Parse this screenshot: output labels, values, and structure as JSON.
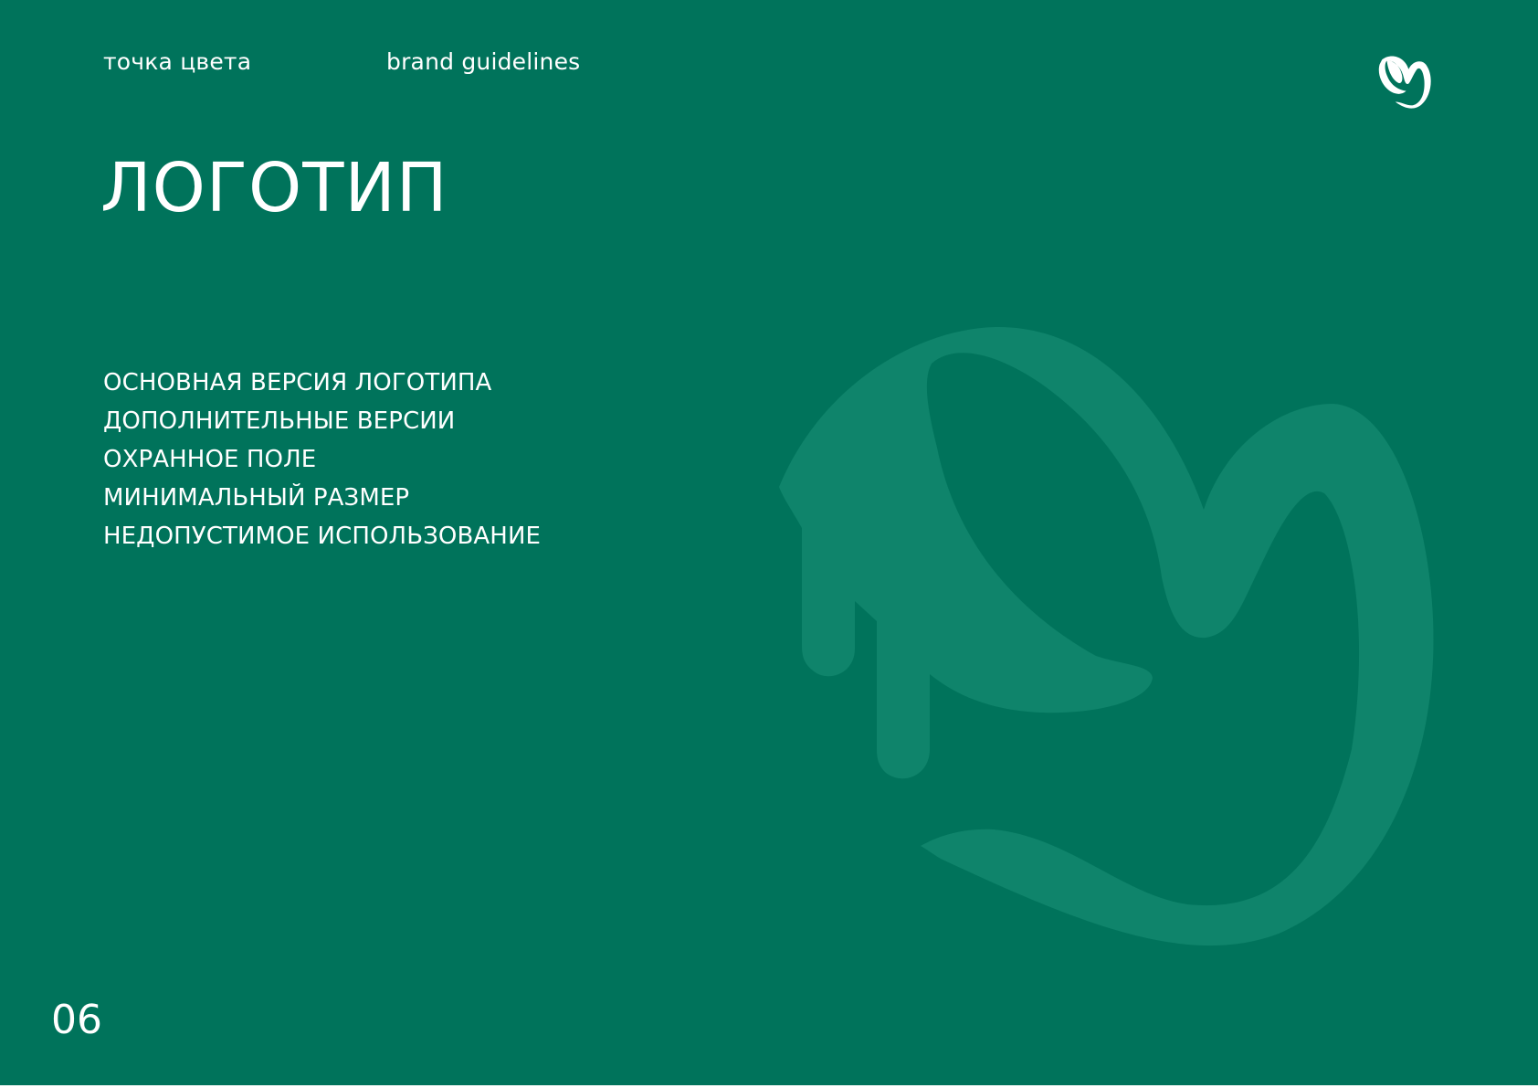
{
  "header": {
    "brand": "точка цвета",
    "subtitle": "brand guidelines",
    "logo_icon": "brand-mark-icon"
  },
  "title": "ЛОГОТИП",
  "contents": [
    "ОСНОВНАЯ ВЕРСИЯ ЛОГОТИПА",
    "ДОПОЛНИТЕЛЬНЫЕ ВЕРСИИ",
    "ОХРАННОЕ ПОЛЕ",
    "МИНИМАЛЬНЫЙ РАЗМЕР",
    "НЕДОПУСТИМОЕ ИСПОЛЬЗОВАНИЕ"
  ],
  "page_number": "06",
  "colors": {
    "background": "#00735b",
    "watermark": "#0f846b",
    "text": "#ffffff"
  }
}
